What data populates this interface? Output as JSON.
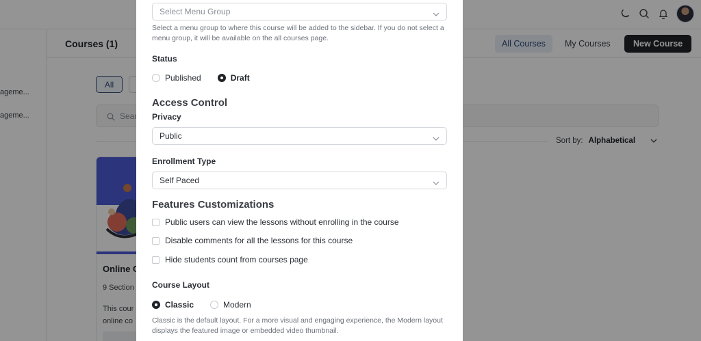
{
  "background": {
    "sidebar_items": [
      "ageme...",
      "ageme..."
    ],
    "page_title": "Courses (1)",
    "header_buttons": {
      "all_courses": "All Courses",
      "my_courses": "My Courses",
      "new_course": "New Course"
    },
    "filter_all": "All",
    "search_placeholder": "Searc",
    "sort_label": "Sort by:",
    "sort_value": "Alphabetical",
    "card": {
      "title": "Online C",
      "sections": "9 Section",
      "desc_line1": "This cour",
      "desc_line2": "online co"
    }
  },
  "modal": {
    "menu_group_select": {
      "placeholder": "Select Menu Group",
      "help": "Select a menu group to where this course will be added to the sidebar. If you do not select a menu group, it will be available on the all courses page."
    },
    "status": {
      "label": "Status",
      "options": [
        "Published",
        "Draft"
      ],
      "selected": "Draft"
    },
    "access_control": {
      "heading": "Access Control",
      "privacy_label": "Privacy",
      "privacy_value": "Public",
      "enrollment_label": "Enrollment Type",
      "enrollment_value": "Self Paced"
    },
    "features": {
      "heading": "Features Customizations",
      "options": [
        "Public users can view the lessons without enrolling in the course",
        "Disable comments for all the lessons for this course",
        "Hide students count from courses page"
      ]
    },
    "course_layout": {
      "label": "Course Layout",
      "options": [
        "Classic",
        "Modern"
      ],
      "selected": "Classic",
      "help": "Classic is the default layout. For a more visual and engaging experience, the Modern layout displays the featured image or embedded video thumbnail."
    }
  },
  "colors": {
    "accent": "#2f4b75",
    "dark": "#1f2328",
    "card_blue": "#4c5bd4"
  }
}
